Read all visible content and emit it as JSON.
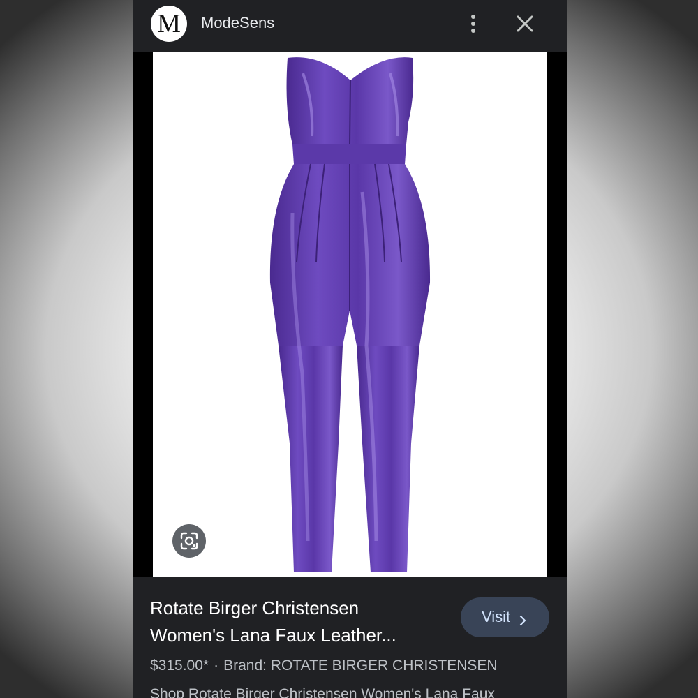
{
  "header": {
    "logo_letter": "M",
    "site_name": "ModeSens",
    "more_icon": "more-vert-icon",
    "close_icon": "close-icon"
  },
  "image": {
    "lens_icon": "visual-search-icon",
    "garment_color": "#5d36a8"
  },
  "result": {
    "title": "Rotate Birger Christensen\nWomen's Lana Faux Leather...",
    "visit_label": "Visit",
    "price": "$315.00*",
    "separator": "·",
    "brand": "Brand: ROTATE BIRGER CHRISTENSEN",
    "snippet": "Shop Rotate Birger Christensen Women's Lana Faux"
  },
  "colors": {
    "panel_bg": "#202124",
    "visit_bg": "#394457",
    "visit_text": "#d2e3fc"
  }
}
